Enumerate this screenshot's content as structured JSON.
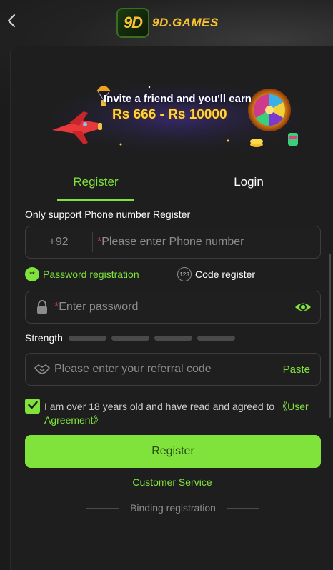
{
  "header": {
    "back_glyph": "‹",
    "logo_badge": "9D",
    "logo_text": "9D.GAMES"
  },
  "banner": {
    "title": "Invite a friend and you'll earn",
    "amount": "Rs 666 - Rs 10000"
  },
  "tabs": [
    {
      "label": "Register",
      "active": true
    },
    {
      "label": "Login",
      "active": false
    }
  ],
  "form": {
    "only_support": "Only support Phone number Register",
    "country_code": "+92",
    "phone_placeholder": "Please enter Phone number",
    "required_mark": "*",
    "mode_password": "Password registration",
    "mode_password_icon": "**",
    "mode_code": "Code register",
    "mode_code_icon": "123",
    "password_placeholder": "Enter password",
    "strength_label": "Strength",
    "strength_level": 0,
    "referral_placeholder": "Please enter your referral code",
    "paste_label": "Paste",
    "agree_checked": true,
    "agree_text": "I am over 18 years old and have read and agreed to ",
    "agree_link": "《User Agreement》",
    "register_button": "Register",
    "customer_service": "Customer Service",
    "binding_registration": "Binding registration"
  },
  "colors": {
    "accent": "#7fe33b",
    "background": "#1b1b1b",
    "card": "#1e1e1e",
    "error": "#e04040",
    "gold": "#f6c232"
  },
  "icons": {
    "back": "chevron-left-icon",
    "lock": "lock-icon",
    "eye": "eye-icon",
    "referral": "handshake-icon",
    "check": "check-icon"
  }
}
